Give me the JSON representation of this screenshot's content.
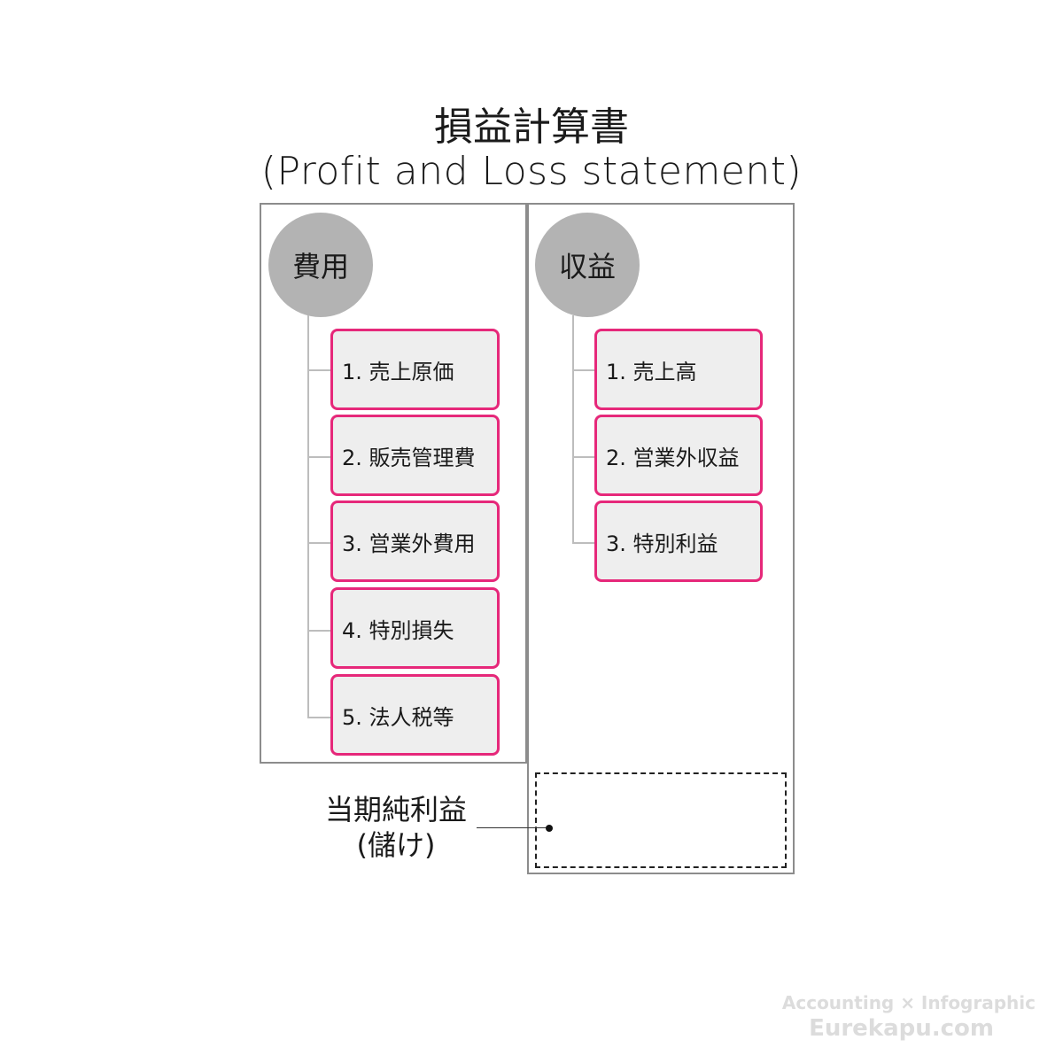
{
  "title": {
    "japanese": "損益計算書",
    "english": "(Profit and Loss statement)"
  },
  "expenses": {
    "heading": "費用",
    "items": [
      {
        "label": "1. 売上原価"
      },
      {
        "label": "2. 販売管理費"
      },
      {
        "label": "3. 営業外費用"
      },
      {
        "label": "4. 特別損失"
      },
      {
        "label": "5. 法人税等"
      }
    ]
  },
  "revenue": {
    "heading": "収益",
    "items": [
      {
        "label": "1. 売上高"
      },
      {
        "label": "2. 営業外収益"
      },
      {
        "label": "3. 特別利益"
      }
    ]
  },
  "net_income": {
    "label_line1": "当期純利益",
    "label_line2": "(儲け)"
  },
  "watermark": {
    "line1": "Accounting × Infographic",
    "line2": "Eurekapu.com"
  },
  "colors": {
    "item_border": "#e6287a",
    "item_fill": "#eeeeee",
    "circle_fill": "#b3b3b3",
    "panel_border": "#8c8c8c"
  }
}
